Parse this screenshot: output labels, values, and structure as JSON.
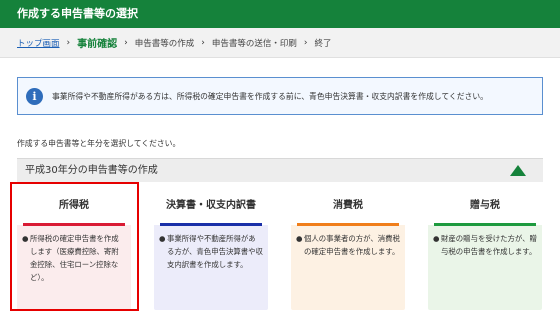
{
  "header": {
    "title": "作成する申告書等の選択"
  },
  "breadcrumb": {
    "items": [
      {
        "label": "トップ画面"
      },
      {
        "label": "事前確認"
      },
      {
        "label": "申告書等の作成"
      },
      {
        "label": "申告書等の送信・印刷"
      },
      {
        "label": "終了"
      }
    ],
    "separator": "›"
  },
  "notice": {
    "icon": "info-icon",
    "icon_glyph": "i",
    "text": "事業所得や不動産所得がある方は、所得税の確定申告書を作成する前に、青色申告決算書・収支内訳書を作成してください。"
  },
  "instruction": "作成する申告書等と年分を選択してください。",
  "section": {
    "title": "平成30年分の申告書等の作成"
  },
  "cards": [
    {
      "title": "所得税",
      "bullet": "●",
      "description": "所得税の確定申告書を作成します（医療費控除、寄附金控除、住宅ローン控除など）。"
    },
    {
      "title": "決算書・収支内訳書",
      "bullet": "●",
      "description": "事業所得や不動産所得がある方が、青色申告決算書や収支内訳書を作成します。"
    },
    {
      "title": "消費税",
      "bullet": "●",
      "description": "個人の事業者の方が、消費税の確定申告書を作成します。"
    },
    {
      "title": "贈与税",
      "bullet": "●",
      "description": "財産の贈与を受けた方が、贈与税の申告書を作成します。"
    }
  ],
  "colors": {
    "header_bg": "#15823b",
    "shotokuzei_accent": "#d91b34",
    "kessansho_accent": "#1a2fa8",
    "shohizei_accent": "#f07e1a",
    "zoyozei_accent": "#1d9a3e",
    "selection_outline": "#e60000"
  }
}
